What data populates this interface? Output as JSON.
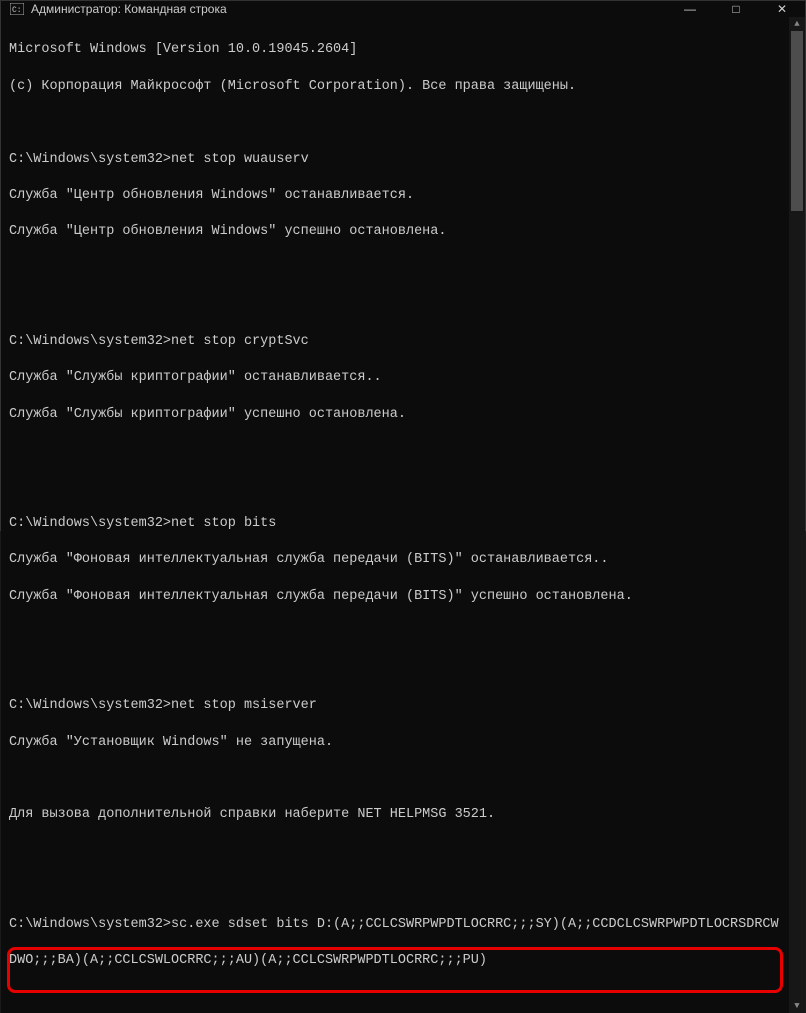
{
  "title_bar": {
    "title": "Администратор: Командная строка",
    "minimize": "—",
    "maximize": "□",
    "close": "✕"
  },
  "terminal": {
    "header_line1": "Microsoft Windows [Version 10.0.19045.2604]",
    "header_line2": "(c) Корпорация Майкрософт (Microsoft Corporation). Все права защищены.",
    "cmd1_prompt": "C:\\Windows\\system32>net stop wuauserv",
    "cmd1_out1": "Служба \"Центр обновления Windows\" останавливается.",
    "cmd1_out2": "Служба \"Центр обновления Windows\" успешно остановлена.",
    "cmd2_prompt": "C:\\Windows\\system32>net stop cryptSvc",
    "cmd2_out1": "Служба \"Службы криптографии\" останавливается..",
    "cmd2_out2": "Служба \"Службы криптографии\" успешно остановлена.",
    "cmd3_prompt": "C:\\Windows\\system32>net stop bits",
    "cmd3_out1": "Служба \"Фоновая интеллектуальная служба передачи (BITS)\" останавливается..",
    "cmd3_out2": "Служба \"Фоновая интеллектуальная служба передачи (BITS)\" успешно остановлена.",
    "cmd4_prompt": "C:\\Windows\\system32>net stop msiserver",
    "cmd4_out1": "Служба \"Установщик Windows\" не запущена.",
    "cmd4_help": "Для вызова дополнительной справки наберите NET HELPMSG 3521.",
    "cmd5_line1": "C:\\Windows\\system32>sc.exe sdset bits D:(A;;CCLCSWRPWPDTLOCRRC;;;SY)(A;;CCDCLCSWRPWPDTLOCRSDRCW",
    "cmd5_line2": "DWO;;;BA)(A;;CCLCSWLOCRRC;;;AU)(A;;CCLCSWRPWPDTLOCRRC;;;PU)"
  },
  "scrollbar": {
    "up": "▲",
    "down": "▼"
  }
}
